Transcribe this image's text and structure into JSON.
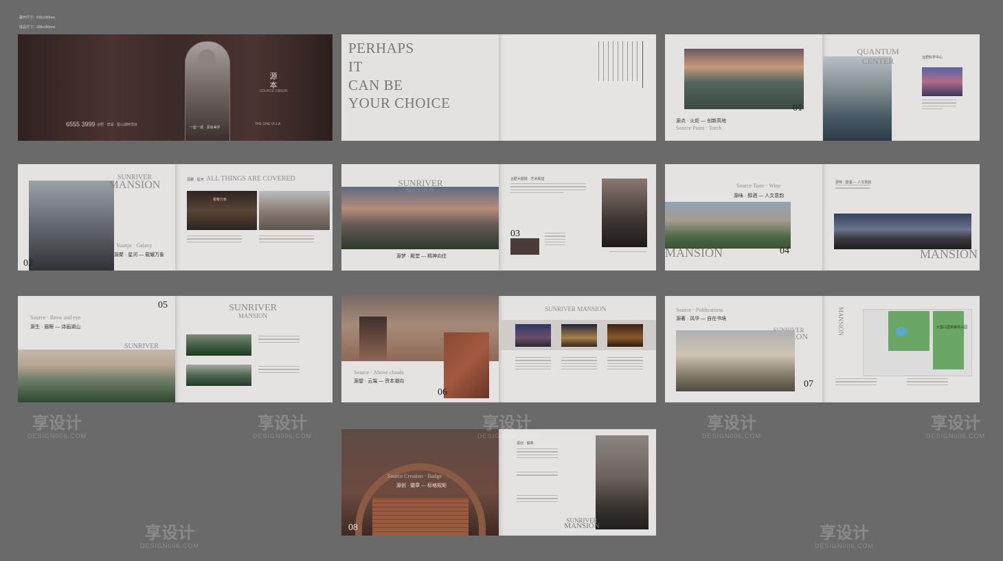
{
  "specs": [
    "展开尺寸：536x160mm",
    "成品尺寸：268x160mm"
  ],
  "watermark": {
    "cn": "享设计",
    "en": "DESIGN006.COM"
  },
  "cover": {
    "phone": "6555 3999",
    "address": "合肥 · 滨湖 · 蜀山湖畔项目",
    "brand": "源本",
    "brand_en": "SOURCE ORIGIN",
    "tagline": "一座一城 · 源象美学",
    "villa": "THE ONE VILLA"
  },
  "s2": {
    "line1": "PERHAPS",
    "line2": "IT",
    "line3": "CAN BE",
    "line4": "YOUR CHOICE"
  },
  "s3": {
    "num": "01",
    "caption": "源点 · 火炬 — 创新高地",
    "sub": "Source Point · Torch",
    "quantum1": "QUANTUM",
    "quantum2": "CENTER",
    "note": "合肥科学中心"
  },
  "s4": {
    "num": "02",
    "caption": "源聚 · 星河 — 载耀万象",
    "sub": "Yuanju · Galaxy",
    "sunriver": "SUNRIVER",
    "mansion": "MANSION",
    "heading": "ALL THINGS ARE COVERED",
    "heading_cn": "源聚 · 星河",
    "shop": "银泰万象"
  },
  "s5": {
    "num": "03",
    "caption": "源梦 · 殿堂 — 精神向往",
    "sunriver": "SUNRIVER",
    "mansion": "MANSION",
    "title": "合肥大剧院 · 艺术殿堂"
  },
  "s6": {
    "num": "04",
    "caption": "源味 · 醇酒 — 人文意韵",
    "sub": "Source Taste · Wine",
    "mansion": "MANSION"
  },
  "s7": {
    "num": "05",
    "caption": "源生 · 眉眼 — 诗画湖山",
    "sub": "Source · Brow and eye",
    "sunriver": "SUNRIVER",
    "mansion": "MANSION"
  },
  "s8": {
    "num": "06",
    "caption": "源望 · 云端 — 资本潮向",
    "sub": "Source · Above clouds",
    "heading": "SUNRIVER MANSION"
  },
  "s9": {
    "num": "07",
    "caption": "源著 · 风华 — 自在书境",
    "sub": "Source · Publications",
    "sunriver": "SUNRIVER",
    "mansion": "MANSION",
    "park": "大蜀山国家森林公园"
  },
  "s10": {
    "num": "08",
    "caption": "源创 · 徽章 — 标格规矩",
    "sub": "Source Creation · Badge",
    "sunriver": "SUNRIVER",
    "mansion": "MANSION",
    "note": "源创 · 徽章"
  },
  "colors": {
    "bg": "#6a6a6a",
    "page": "#e4e3e1",
    "cover": "#3d2a29",
    "accent": "#8f8a86"
  }
}
